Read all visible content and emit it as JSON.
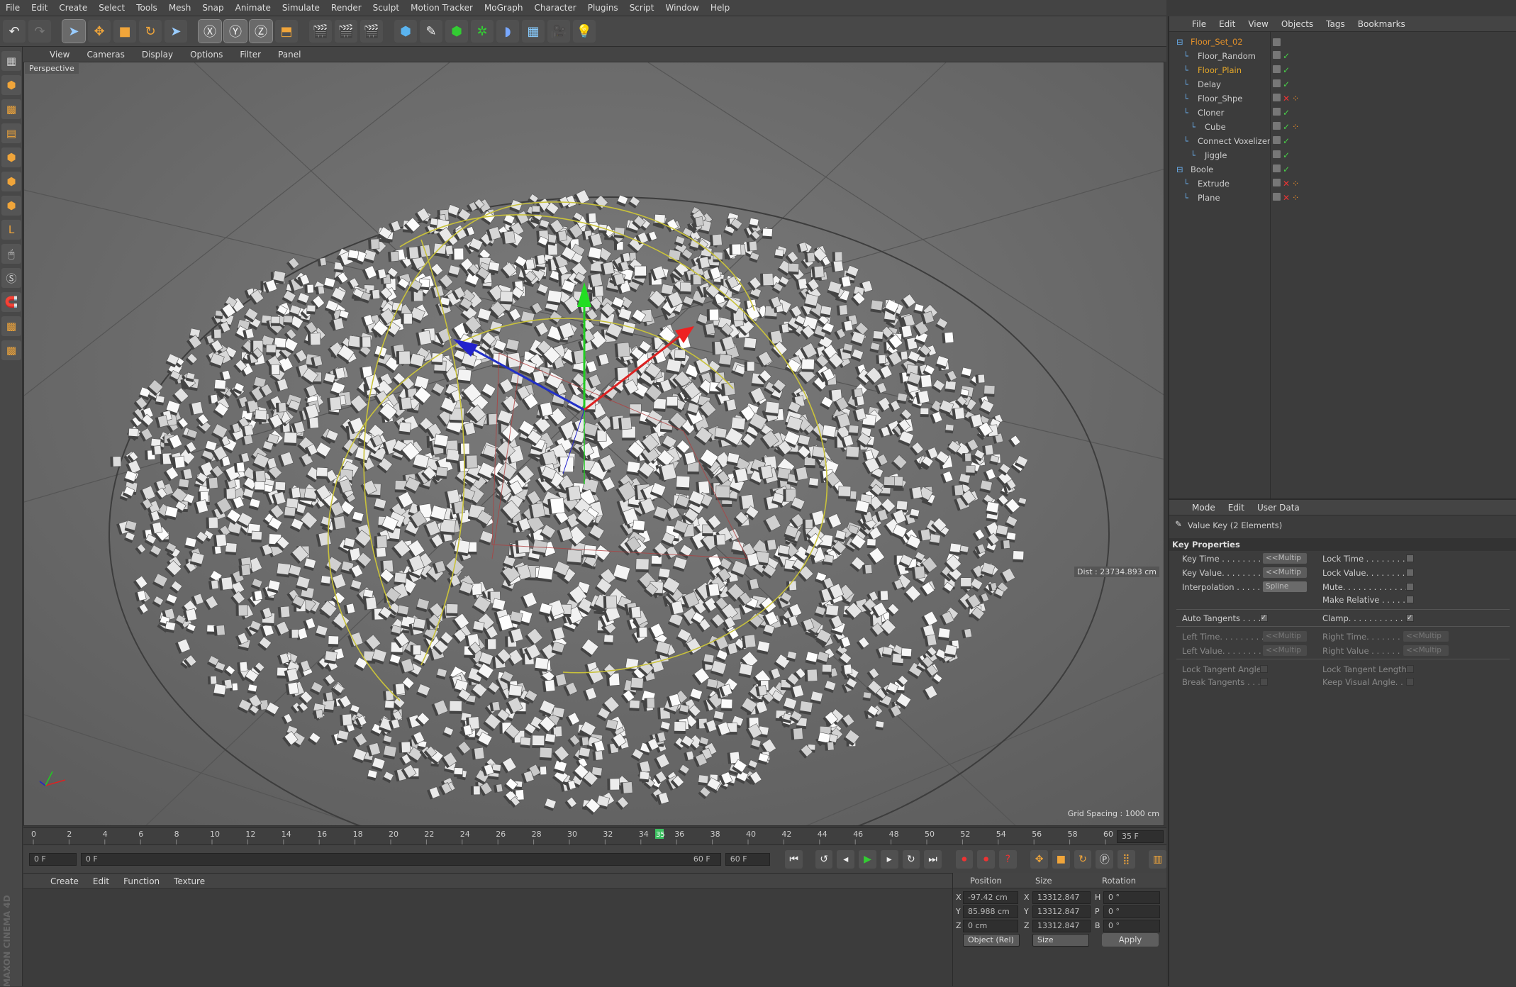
{
  "menubar": [
    "File",
    "Edit",
    "Create",
    "Select",
    "Tools",
    "Mesh",
    "Snap",
    "Animate",
    "Simulate",
    "Render",
    "Sculpt",
    "Motion Tracker",
    "MoGraph",
    "Character",
    "Plugins",
    "Script",
    "Window",
    "Help"
  ],
  "viewport": {
    "menu": [
      "View",
      "Cameras",
      "Display",
      "Options",
      "Filter",
      "Panel"
    ],
    "label": "Perspective",
    "dist": "Dist : 23734.893 cm",
    "grid_spacing": "Grid Spacing : 1000 cm"
  },
  "timeline": {
    "ticks": [
      "0",
      "2",
      "4",
      "6",
      "8",
      "10",
      "12",
      "14",
      "16",
      "18",
      "20",
      "22",
      "24",
      "26",
      "28",
      "30",
      "32",
      "34",
      "36",
      "38",
      "40",
      "42",
      "44",
      "46",
      "48",
      "50",
      "52",
      "54",
      "56",
      "58",
      "60"
    ],
    "current_frame": "35",
    "current_frame_field": "35 F",
    "start_field": "0 F",
    "range_start": "0 F",
    "range_end": "60 F",
    "end_field": "60 F"
  },
  "materials": {
    "menu": [
      "Create",
      "Edit",
      "Function",
      "Texture"
    ]
  },
  "coords": {
    "headers": [
      "Position",
      "Size",
      "Rotation"
    ],
    "rows": [
      {
        "axis": "X",
        "pos": "-97.42 cm",
        "size_axis": "X",
        "size": "13312.847 cm",
        "rot_axis": "H",
        "rot": "0 °"
      },
      {
        "axis": "Y",
        "pos": "85.988 cm",
        "size_axis": "Y",
        "size": "13312.847 cm",
        "rot_axis": "P",
        "rot": "0 °"
      },
      {
        "axis": "Z",
        "pos": "0 cm",
        "size_axis": "Z",
        "size": "13312.847 cm",
        "rot_axis": "B",
        "rot": "0 °"
      }
    ],
    "mode": "Object (Rel)",
    "size_mode": "Size",
    "apply": "Apply"
  },
  "objmgr": {
    "menu": [
      "File",
      "Edit",
      "View",
      "Objects",
      "Tags",
      "Bookmarks"
    ],
    "objects": [
      {
        "name": "Floor_Set_02",
        "indent": 0,
        "color": "#e2902a"
      },
      {
        "name": "Floor_Random",
        "indent": 1,
        "color": "#cccccc"
      },
      {
        "name": "Floor_Plain",
        "indent": 1,
        "color": "#e2a62a"
      },
      {
        "name": "Delay",
        "indent": 1,
        "color": "#cccccc"
      },
      {
        "name": "Floor_Shpe",
        "indent": 1,
        "color": "#cccccc"
      },
      {
        "name": "Cloner",
        "indent": 1,
        "color": "#cccccc"
      },
      {
        "name": "Cube",
        "indent": 2,
        "color": "#cccccc"
      },
      {
        "name": "Connect Voxelizer",
        "indent": 1,
        "color": "#cccccc"
      },
      {
        "name": "Jiggle",
        "indent": 2,
        "color": "#cccccc"
      },
      {
        "name": "Boole",
        "indent": 0,
        "color": "#cccccc"
      },
      {
        "name": "Extrude",
        "indent": 1,
        "color": "#cccccc"
      },
      {
        "name": "Plane",
        "indent": 1,
        "color": "#cccccc"
      }
    ]
  },
  "attrmgr": {
    "menu": [
      "Mode",
      "Edit",
      "User Data"
    ],
    "title": "Value Key (2 Elements)",
    "section": "Key Properties",
    "left": [
      {
        "label": "Key Time . . . . . . . . .",
        "value": "<<Multip"
      },
      {
        "label": "Key Value. . . . . . . . .",
        "value": "<<Multip"
      },
      {
        "label": "Interpolation . . . . . .",
        "value": "Spline"
      }
    ],
    "right": [
      {
        "label": "Lock Time . . . . . . . . ."
      },
      {
        "label": "Lock Value. . . . . . . . ."
      },
      {
        "label": "Mute. . . . . . . . . . . . . ."
      },
      {
        "label": "Make Relative . . . . ."
      }
    ],
    "auto_tangents": "Auto Tangents . . . . .",
    "clamp": "Clamp. . . . . . . . . . . . .",
    "left_time": "Left  Time. . . . . . . . .",
    "left_value": "Left  Value. . . . . . . .",
    "right_time": "Right Time. . . . . . . . .",
    "right_value": "Right Value . . . . . . .",
    "multip": "<<Multip",
    "lock_tangent_angles": "Lock Tangent Angles",
    "break_tangents": "Break Tangents . . . .",
    "lock_tangent_lengths": "Lock Tangent Lengths",
    "keep_visual_angle": "Keep Visual Angle. . . ."
  },
  "brand": "MAXON CINEMA 4D"
}
